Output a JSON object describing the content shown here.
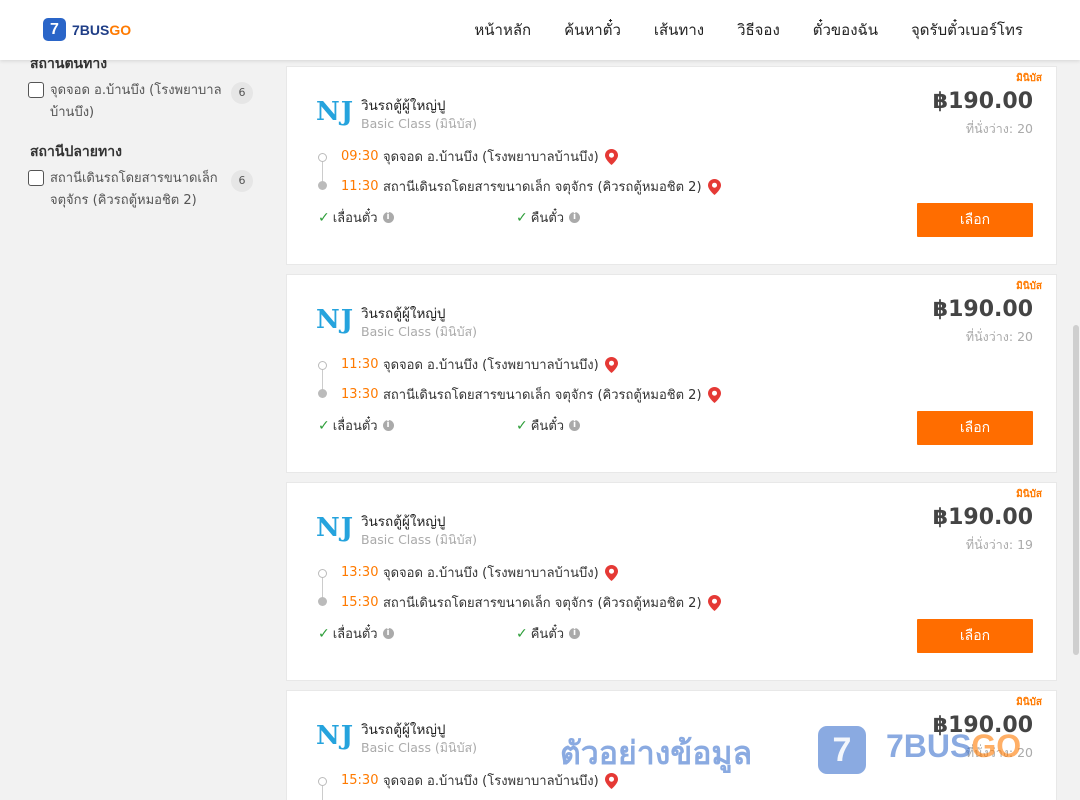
{
  "header": {
    "logo_mark": "7",
    "logo_bus": "7BUS",
    "logo_go": "GO",
    "nav": [
      "หน้าหลัก",
      "ค้นหาตั๋ว",
      "เส้นทาง",
      "วิธีจอง",
      "ตั๋วของฉัน",
      "จุดรับตั๋วเบอร์โทร"
    ]
  },
  "sidebar": {
    "origin_title": "สถานีต้นทาง",
    "origin_items": [
      {
        "label": "จุดจอด อ.บ้านบึง (โรงพยาบาลบ้านบึง)",
        "count": "6"
      }
    ],
    "dest_title": "สถานีปลายทาง",
    "dest_items": [
      {
        "label": "สถานีเดินรถโดยสารขนาดเล็ก จตุจักร (คิวรถตู้หมอชิต 2)",
        "count": "6"
      }
    ]
  },
  "trips": [
    {
      "tag": "มินิบัส",
      "logo": "NJ",
      "operator": "วินรถตู้ผู้ใหญ่ปู",
      "class": "Basic Class (มินิบัส)",
      "price": "฿190.00",
      "seats": "ที่นั่งว่าง: 20",
      "depart_time": "09:30",
      "depart_stop": "จุดจอด อ.บ้านบึง (โรงพยาบาลบ้านบึง)",
      "arrive_time": "11:30",
      "arrive_stop": "สถานีเดินรถโดยสารขนาดเล็ก จตุจักร (คิวรถตู้หมอชิต 2)",
      "policy1": "เลื่อนตั๋ว",
      "policy2": "คืนตั๋ว",
      "select": "เลือก"
    },
    {
      "tag": "มินิบัส",
      "logo": "NJ",
      "operator": "วินรถตู้ผู้ใหญ่ปู",
      "class": "Basic Class (มินิบัส)",
      "price": "฿190.00",
      "seats": "ที่นั่งว่าง: 20",
      "depart_time": "11:30",
      "depart_stop": "จุดจอด อ.บ้านบึง (โรงพยาบาลบ้านบึง)",
      "arrive_time": "13:30",
      "arrive_stop": "สถานีเดินรถโดยสารขนาดเล็ก จตุจักร (คิวรถตู้หมอชิต 2)",
      "policy1": "เลื่อนตั๋ว",
      "policy2": "คืนตั๋ว",
      "select": "เลือก"
    },
    {
      "tag": "มินิบัส",
      "logo": "NJ",
      "operator": "วินรถตู้ผู้ใหญ่ปู",
      "class": "Basic Class (มินิบัส)",
      "price": "฿190.00",
      "seats": "ที่นั่งว่าง: 19",
      "depart_time": "13:30",
      "depart_stop": "จุดจอด อ.บ้านบึง (โรงพยาบาลบ้านบึง)",
      "arrive_time": "15:30",
      "arrive_stop": "สถานีเดินรถโดยสารขนาดเล็ก จตุจักร (คิวรถตู้หมอชิต 2)",
      "policy1": "เลื่อนตั๋ว",
      "policy2": "คืนตั๋ว",
      "select": "เลือก"
    },
    {
      "tag": "มินิบัส",
      "logo": "NJ",
      "operator": "วินรถตู้ผู้ใหญ่ปู",
      "class": "Basic Class (มินิบัส)",
      "price": "฿190.00",
      "seats": "ที่นั่งว่าง: 20",
      "depart_time": "15:30",
      "depart_stop": "จุดจอด อ.บ้านบึง (โรงพยาบาลบ้านบึง)",
      "arrive_time": "",
      "arrive_stop": "",
      "policy1": "",
      "policy2": "",
      "select": ""
    }
  ],
  "watermark": {
    "text": "ตัวอย่างข้อมูล",
    "mark": "7",
    "brand_a": "7BUS",
    "brand_b": "GO"
  },
  "colors": {
    "accent": "#ff6d00",
    "time": "#ff7a00",
    "brand_blue": "#2a65c8",
    "check": "#2e9e3a",
    "pin": "#e53935"
  },
  "icons": {
    "location": "map-pin-icon",
    "check": "check-icon",
    "info": "info-icon"
  }
}
